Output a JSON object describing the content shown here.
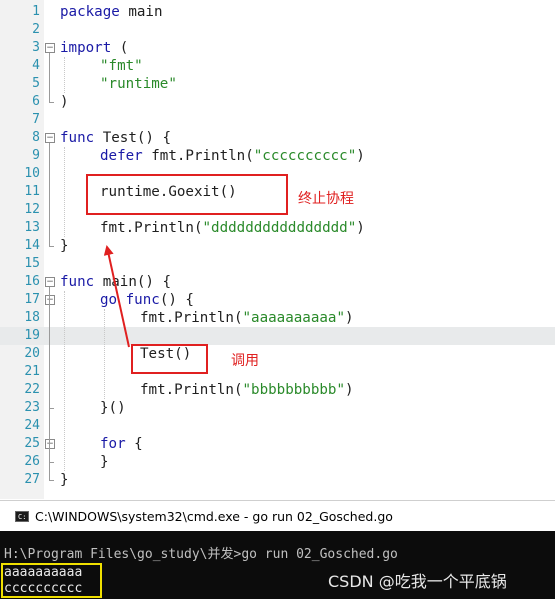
{
  "editor": {
    "lines": [
      {
        "n": "1",
        "indent": 0,
        "tokens": [
          {
            "t": "package",
            "c": "kw"
          },
          {
            "t": " main",
            "c": ""
          }
        ]
      },
      {
        "n": "2",
        "indent": 0,
        "tokens": []
      },
      {
        "n": "3",
        "indent": 0,
        "tokens": [
          {
            "t": "import",
            "c": "kw"
          },
          {
            "t": " (",
            "c": ""
          }
        ]
      },
      {
        "n": "4",
        "indent": 1,
        "tokens": [
          {
            "t": "\"fmt\"",
            "c": "str"
          }
        ]
      },
      {
        "n": "5",
        "indent": 1,
        "tokens": [
          {
            "t": "\"runtime\"",
            "c": "str"
          }
        ]
      },
      {
        "n": "6",
        "indent": 0,
        "tokens": [
          {
            "t": ")",
            "c": ""
          }
        ]
      },
      {
        "n": "7",
        "indent": 0,
        "tokens": []
      },
      {
        "n": "8",
        "indent": 0,
        "tokens": [
          {
            "t": "func",
            "c": "kw"
          },
          {
            "t": " Test() {",
            "c": ""
          }
        ]
      },
      {
        "n": "9",
        "indent": 1,
        "tokens": [
          {
            "t": "defer",
            "c": "kw"
          },
          {
            "t": " fmt.Println(",
            "c": ""
          },
          {
            "t": "\"cccccccccc\"",
            "c": "str"
          },
          {
            "t": ")",
            "c": ""
          }
        ]
      },
      {
        "n": "10",
        "indent": 0,
        "tokens": []
      },
      {
        "n": "11",
        "indent": 1,
        "tokens": [
          {
            "t": "runtime.Goexit()",
            "c": ""
          }
        ]
      },
      {
        "n": "12",
        "indent": 0,
        "tokens": []
      },
      {
        "n": "13",
        "indent": 1,
        "tokens": [
          {
            "t": "fmt.Println(",
            "c": ""
          },
          {
            "t": "\"dddddddddddddddd\"",
            "c": "str"
          },
          {
            "t": ")",
            "c": ""
          }
        ]
      },
      {
        "n": "14",
        "indent": 0,
        "tokens": [
          {
            "t": "}",
            "c": ""
          }
        ]
      },
      {
        "n": "15",
        "indent": 0,
        "tokens": []
      },
      {
        "n": "16",
        "indent": 0,
        "tokens": [
          {
            "t": "func",
            "c": "kw"
          },
          {
            "t": " main() {",
            "c": ""
          }
        ]
      },
      {
        "n": "17",
        "indent": 1,
        "tokens": [
          {
            "t": "go",
            "c": "kw"
          },
          {
            "t": " ",
            "c": ""
          },
          {
            "t": "func",
            "c": "kw"
          },
          {
            "t": "() {",
            "c": ""
          }
        ]
      },
      {
        "n": "18",
        "indent": 2,
        "tokens": [
          {
            "t": "fmt.Println(",
            "c": ""
          },
          {
            "t": "\"aaaaaaaaaa\"",
            "c": "str"
          },
          {
            "t": ")",
            "c": ""
          }
        ]
      },
      {
        "n": "19",
        "indent": 0,
        "tokens": []
      },
      {
        "n": "20",
        "indent": 2,
        "tokens": [
          {
            "t": "Test()",
            "c": ""
          }
        ]
      },
      {
        "n": "21",
        "indent": 0,
        "tokens": []
      },
      {
        "n": "22",
        "indent": 2,
        "tokens": [
          {
            "t": "fmt.Println(",
            "c": ""
          },
          {
            "t": "\"bbbbbbbbbb\"",
            "c": "str"
          },
          {
            "t": ")",
            "c": ""
          }
        ]
      },
      {
        "n": "23",
        "indent": 1,
        "tokens": [
          {
            "t": "}()",
            "c": ""
          }
        ]
      },
      {
        "n": "24",
        "indent": 0,
        "tokens": []
      },
      {
        "n": "25",
        "indent": 1,
        "tokens": [
          {
            "t": "for",
            "c": "kw"
          },
          {
            "t": " {",
            "c": ""
          }
        ]
      },
      {
        "n": "26",
        "indent": 1,
        "tokens": [
          {
            "t": "}",
            "c": ""
          }
        ]
      },
      {
        "n": "27",
        "indent": 0,
        "tokens": [
          {
            "t": "}",
            "c": ""
          }
        ]
      }
    ],
    "highlighted_line": "19",
    "fold_lines": [
      "3",
      "8",
      "16",
      "17",
      "25"
    ],
    "annotations": {
      "goexit_label": "终止协程",
      "call_label": "调用"
    },
    "colors": {
      "keyword": "#1a1aa6",
      "string": "#2a8a2a",
      "line_number": "#2b91af",
      "annotation": "#e02020",
      "output_box": "#f0e000"
    }
  },
  "console": {
    "title": "C:\\WINDOWS\\system32\\cmd.exe - go  run 02_Gosched.go",
    "icon": "cmd-window-icon",
    "prompt_line": "H:\\Program Files\\go_study\\并发>go run 02_Gosched.go",
    "output": [
      "aaaaaaaaaa",
      "cccccccccc"
    ]
  },
  "watermark": "CSDN @吃我一个平底锅"
}
